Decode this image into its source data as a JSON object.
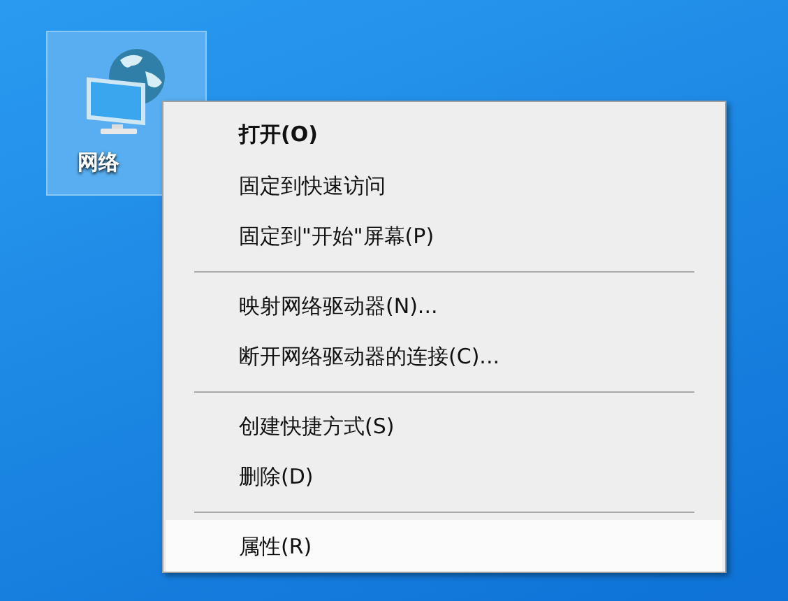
{
  "desktop_icon": {
    "label": "网络",
    "selected": true
  },
  "context_menu": {
    "items": [
      {
        "kind": "item",
        "label": "打开(O)",
        "bold": true,
        "selected": false
      },
      {
        "kind": "item",
        "label": "固定到快速访问",
        "bold": false,
        "selected": false
      },
      {
        "kind": "item",
        "label": "固定到\"开始\"屏幕(P)",
        "bold": false,
        "selected": false
      },
      {
        "kind": "separator"
      },
      {
        "kind": "item",
        "label": "映射网络驱动器(N)...",
        "bold": false,
        "selected": false
      },
      {
        "kind": "item",
        "label": "断开网络驱动器的连接(C)...",
        "bold": false,
        "selected": false
      },
      {
        "kind": "separator"
      },
      {
        "kind": "item",
        "label": "创建快捷方式(S)",
        "bold": false,
        "selected": false
      },
      {
        "kind": "item",
        "label": "删除(D)",
        "bold": false,
        "selected": false
      },
      {
        "kind": "separator"
      },
      {
        "kind": "item",
        "label": "属性(R)",
        "bold": false,
        "selected": true
      }
    ]
  }
}
